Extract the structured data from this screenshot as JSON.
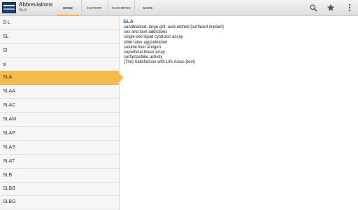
{
  "app": {
    "title": "Abbreviations",
    "subtitle": "SLA"
  },
  "tabs": [
    {
      "label": "HOME"
    },
    {
      "label": "HISTORY"
    },
    {
      "label": "FAVORITES"
    },
    {
      "label": "MORE"
    }
  ],
  "actions": {
    "search_icon": "search-icon",
    "star_icon": "star-icon",
    "overflow_icon": "overflow-menu-icon"
  },
  "colors": {
    "accent": "#f7bb4a",
    "term_title": "#1a5a96",
    "logo": "#1f3f6f"
  },
  "list": {
    "items": [
      "S-L",
      "SL",
      "Sl",
      "sl",
      "SLA",
      "SLAA",
      "SLAC",
      "SLAM",
      "SLAP",
      "SLAS",
      "SLAT",
      "SLB",
      "SLBB",
      "SLBG"
    ],
    "selected": "SLA"
  },
  "detail": {
    "term": "SLA",
    "definitions": [
      "sandblasted, large-grit, acid-etched [surfaced implant]",
      "sex and love addictions",
      "single-cell liquid cytotoxic assay",
      "slide latex agglutination",
      "soluble liver antigen",
      "superficial linear array",
      "surfactantlike activity",
      "[The] Satisfaction with Life Areas [test]"
    ]
  }
}
